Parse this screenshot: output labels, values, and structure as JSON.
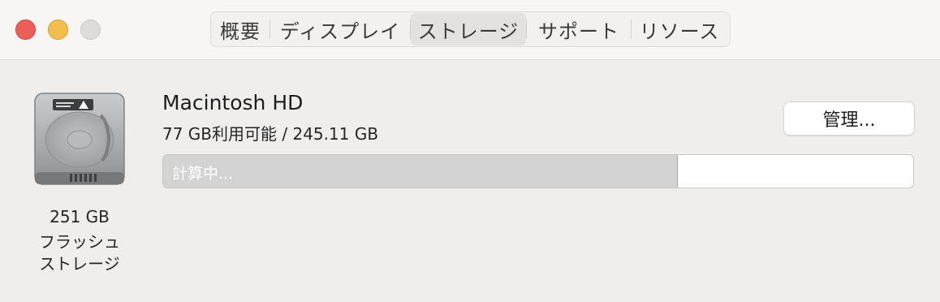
{
  "window": {
    "controls": [
      "close",
      "minimize",
      "zoom"
    ],
    "colors": {
      "close": "#ec5f57",
      "minimize": "#f4be4f",
      "zoom": "#dddcdb"
    }
  },
  "tabs": [
    {
      "label": "概要",
      "active": false
    },
    {
      "label": "ディスプレイ",
      "active": false
    },
    {
      "label": "ストレージ",
      "active": true
    },
    {
      "label": "サポート",
      "active": false
    },
    {
      "label": "リソース",
      "active": false
    }
  ],
  "disk": {
    "icon": "hard-disk-icon",
    "caption_line1": "251 GB",
    "caption_line2": "フラッシュ",
    "caption_line3": "ストレージ"
  },
  "volume": {
    "name": "Macintosh HD",
    "availability": "77 GB利用可能 / 245.11 GB",
    "manage_button": "管理...",
    "bar_label": "計算中...",
    "used_fraction": 0.686
  }
}
